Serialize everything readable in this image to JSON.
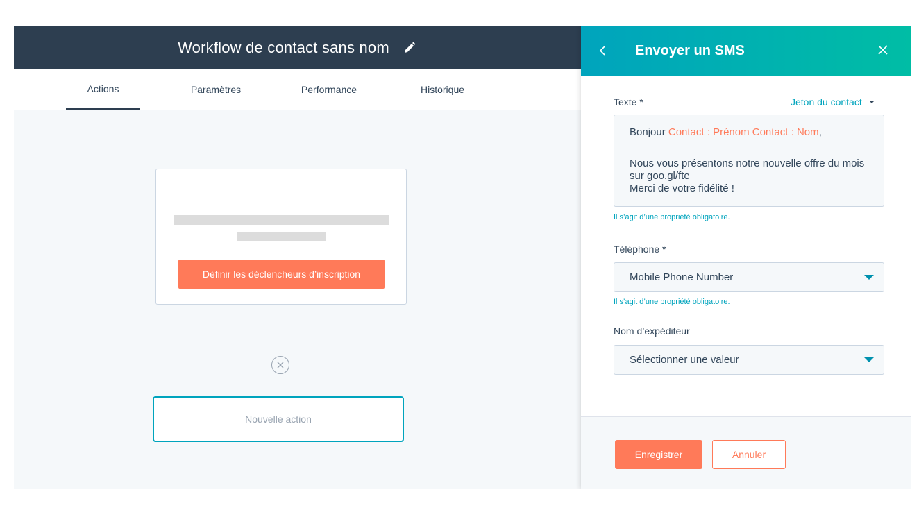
{
  "workflow": {
    "title": "Workflow de contact sans nom",
    "edit_icon": "pencil-icon"
  },
  "tabs": [
    {
      "label": "Actions",
      "active": true
    },
    {
      "label": "Paramètres",
      "active": false
    },
    {
      "label": "Performance",
      "active": false
    },
    {
      "label": "Historique",
      "active": false
    }
  ],
  "canvas": {
    "trigger_button": "Définir les déclencheurs d’inscription",
    "remove_icon": "close-circle-icon",
    "new_action_label": "Nouvelle action"
  },
  "panel": {
    "title": "Envoyer un SMS",
    "back_icon": "chevron-left-icon",
    "close_icon": "close-icon",
    "text_label": "Texte *",
    "token_label": "Jeton du contact",
    "message": {
      "greeting": "Bonjour ",
      "token_text": "Contact : Prénom Contact : Nom",
      "greeting_end": ",",
      "body_line1": "Nous vous présentons notre nouvelle offre du mois sur goo.gl/fte",
      "body_line2": "Merci de votre fidélité !"
    },
    "required_hint": "Il s’agit d’une propriété obligatoire.",
    "phone_label": "Téléphone *",
    "phone_value": "Mobile Phone Number",
    "sender_label": "Nom d’expéditeur",
    "sender_placeholder": "Sélectionner une valeur",
    "save_label": "Enregistrer",
    "cancel_label": "Annuler"
  },
  "colors": {
    "header_dark": "#2d3e50",
    "accent_orange": "#ff7a59",
    "accent_teal": "#00a4bd",
    "panel_gradient_end": "#00bda5"
  }
}
